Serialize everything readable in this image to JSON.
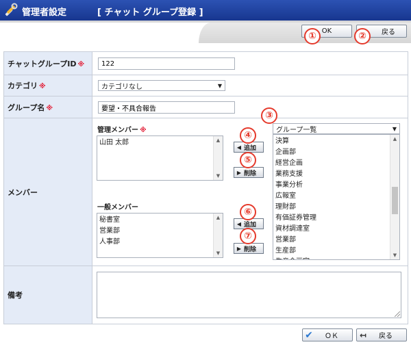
{
  "header": {
    "title": "管理者設定",
    "subtitle": "[ チャット グループ登録 ]"
  },
  "toolbar": {
    "ok_label": "OK",
    "back_label": "戻る"
  },
  "footer": {
    "ok_label": "ＯＫ",
    "back_label": "戻る"
  },
  "required_mark": "※",
  "form": {
    "group_id_label": "チャットグループID",
    "group_id_value": "122",
    "category_label": "カテゴリ",
    "category_value": "カテゴリなし",
    "group_name_label": "グループ名",
    "group_name_value": "要望・不具合報告",
    "members_label": "メンバー",
    "admin_members_label": "管理メンバー",
    "admin_members": [
      "山田 太郎"
    ],
    "general_members_label": "一般メンバー",
    "general_members": [
      "秘書室",
      "営業部",
      "人事部"
    ],
    "group_list_select": "グループ一覧",
    "group_list": [
      "決算",
      "企画部",
      "経営企画",
      "業務支援",
      "事業分析",
      "広報室",
      "理財部",
      "有価証券管理",
      "資材調達室",
      "営業部",
      "生産部",
      "生産企画室"
    ],
    "add_label": "追加",
    "remove_label": "削除",
    "notes_label": "備考",
    "notes_value": ""
  },
  "callouts": [
    "①",
    "②",
    "③",
    "④",
    "⑤",
    "⑥",
    "⑦"
  ]
}
